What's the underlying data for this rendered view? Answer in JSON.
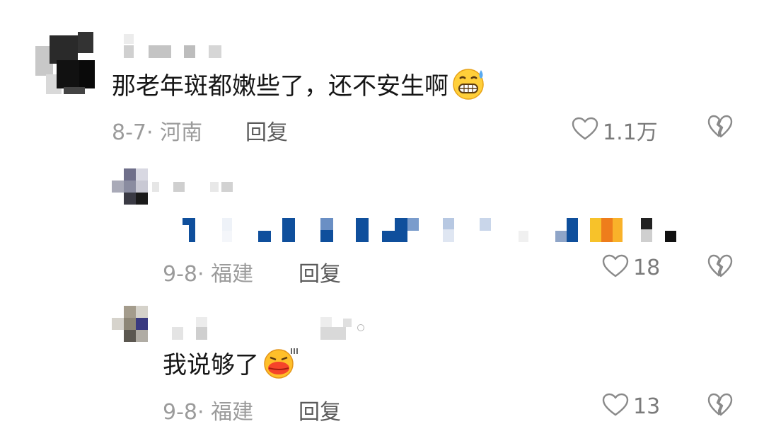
{
  "comments": [
    {
      "text": "那老年斑都嫩些了，还不安生啊",
      "emoji": "grimace-sweat-emoji",
      "date": "8-7",
      "sep": "·",
      "location": "河南",
      "reply_label": "回复",
      "likes": "1.1万"
    },
    {
      "text": "",
      "date": "9-8",
      "sep": "·",
      "location": "福建",
      "reply_label": "回复",
      "likes": "18"
    },
    {
      "text": "我说够了",
      "emoji": "angry-lips-emoji",
      "date": "9-8",
      "sep": "·",
      "location": "福建",
      "reply_label": "回复",
      "likes": "13"
    }
  ],
  "colors": {
    "meta": "#9b9b9b",
    "reply": "#5a5a5a",
    "text": "#161616",
    "mosaic_blue": "#0f4f9c"
  },
  "icons": [
    "heart-outline-icon",
    "broken-heart-icon"
  ]
}
